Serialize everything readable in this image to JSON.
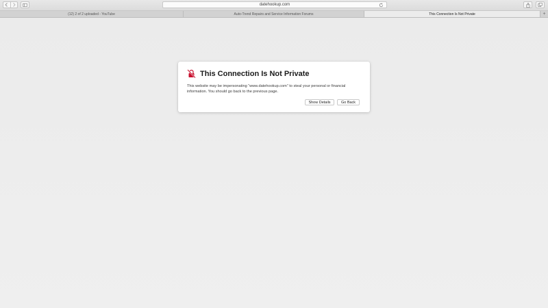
{
  "toolbar": {
    "address_text": "datehookup.com",
    "icons": {
      "back": "chevron-left-icon",
      "forward": "chevron-right-icon",
      "sidebar": "sidebar-icon",
      "reload": "reload-icon",
      "share": "share-icon",
      "tabs": "tabs-overview-icon"
    }
  },
  "tabs": [
    {
      "label": "(12) 2 of 2 uploaded - YouTube",
      "active": false
    },
    {
      "label": "Auto-Trend Repairs and Service Information Forums",
      "active": false
    },
    {
      "label": "This Connection Is Not Private",
      "active": true
    }
  ],
  "tab_add_label": "+",
  "dialog": {
    "icon": "broken-lock-icon",
    "title": "This Connection Is Not Private",
    "body_line1": "This website may be impersonating “www.datehookup.com” to steal your personal or financial",
    "body_line2": "information. You should go back to the previous page.",
    "details_label": "Show Details",
    "back_label": "Go Back"
  },
  "colors": {
    "warning_red": "#c8102e",
    "background": "#ececec"
  }
}
